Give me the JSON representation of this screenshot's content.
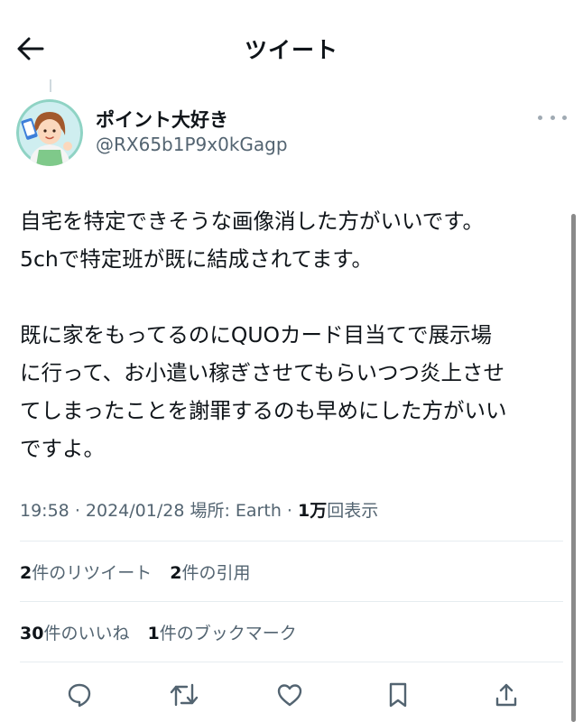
{
  "header": {
    "title": "ツイート"
  },
  "author": {
    "display_name": "ポイント大好き",
    "handle": "@RX65b1P9x0kGagp"
  },
  "tweet": {
    "text": "自宅を特定できそうな画像消した方がいいです。\n5chで特定班が既に結成されてます。\n\n既に家をもってるのにQUOカード目当てで展示場\nに行って、お小遣い稼ぎさせてもらいつつ炎上させ\nてしまったことを謝罪するのも早めにした方がいい\nですよ。"
  },
  "meta": {
    "time": "19:58",
    "date": "2024/01/28",
    "location": "場所: Earth",
    "views_count": "1万",
    "views_label": "回表示"
  },
  "stats": {
    "retweets_count": "2",
    "retweets_label": "件のリツイート",
    "quotes_count": "2",
    "quotes_label": "件の引用",
    "likes_count": "30",
    "likes_label": "件のいいね",
    "bookmarks_count": "1",
    "bookmarks_label": "件のブックマーク"
  },
  "icons": {
    "back": "arrow-left-icon",
    "more": "more-horizontal-icon",
    "reply": "reply-icon",
    "retweet": "retweet-icon",
    "like": "heart-icon",
    "bookmark": "bookmark-icon",
    "share": "share-icon"
  },
  "colors": {
    "text": "#0f1419",
    "secondary": "#536471",
    "divider": "#e6ecf0",
    "icon": "#536471"
  }
}
